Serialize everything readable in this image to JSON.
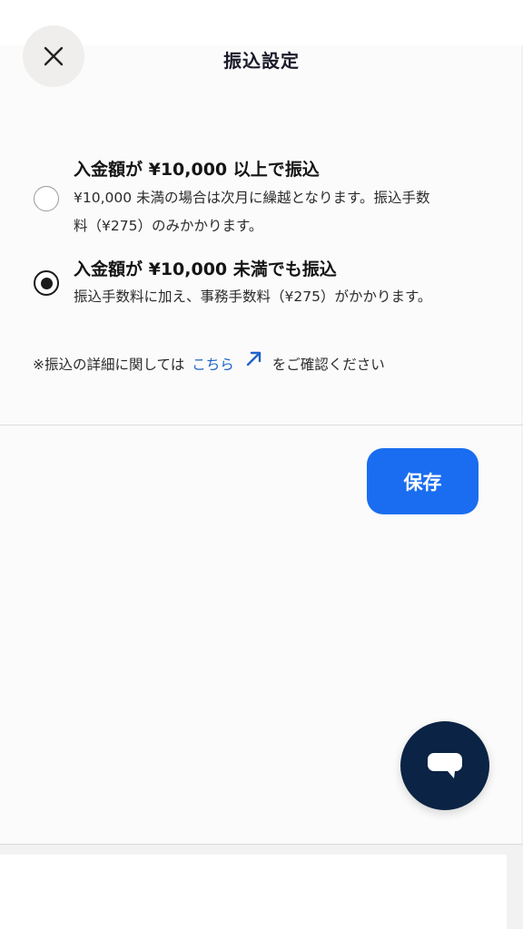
{
  "header": {
    "title": "振込設定",
    "close_icon": "close-icon"
  },
  "options": [
    {
      "title": "入金額が ¥10,000 以上で振込",
      "description_line1": "¥10,000 未満の場合は次月に繰越となります。振込手数",
      "description_line2": "料（¥275）のみかかります。",
      "selected": false
    },
    {
      "title": "入金額が ¥10,000 未満でも振込",
      "description_line1": "振込手数料に加え、事務手数料（¥275）がかかります。",
      "selected": true
    }
  ],
  "note": {
    "prefix": "※振込の詳細に関しては",
    "link_text": "こちら",
    "suffix": "をご確認ください",
    "link_icon": "external-arrow-icon"
  },
  "actions": {
    "save_label": "保存"
  },
  "chat": {
    "icon": "chat-bubble-icon"
  },
  "colors": {
    "accent": "#1a6df0",
    "link": "#1f63c8",
    "fab": "#0b2344"
  }
}
